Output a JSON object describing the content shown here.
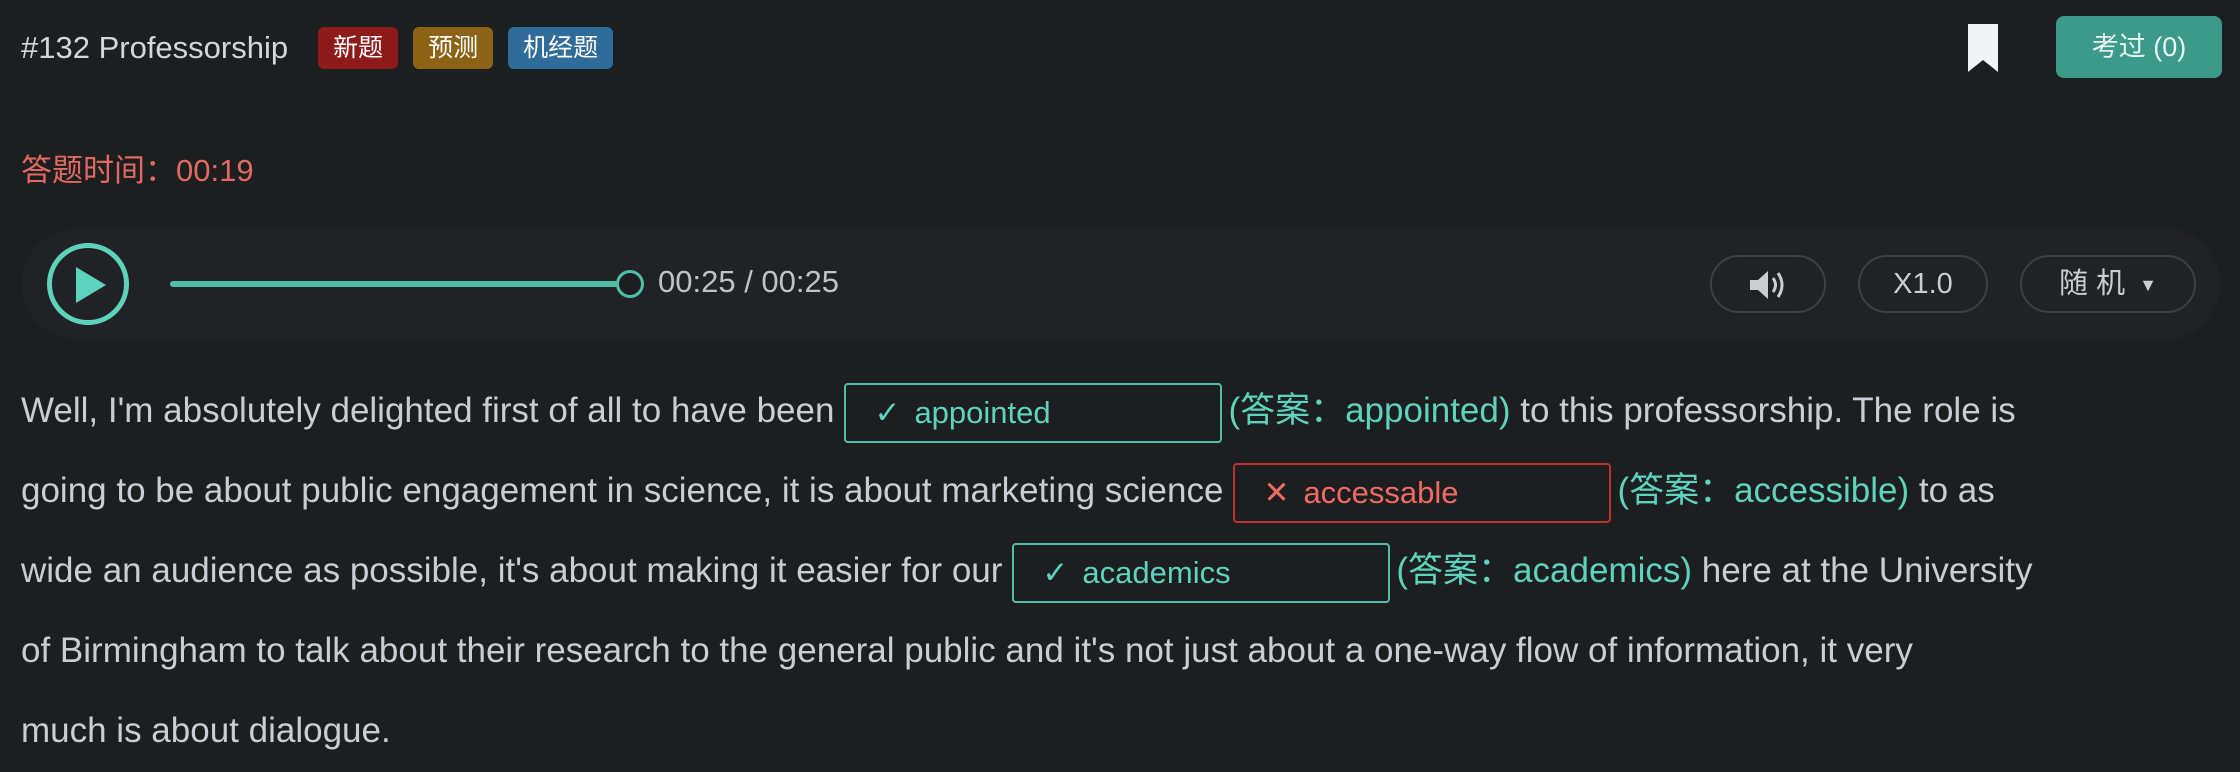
{
  "header": {
    "title": "#132 Professorship",
    "tags": {
      "new": "新题",
      "predict": "预测",
      "machine": "机经题"
    },
    "done_button": "考过 (0)"
  },
  "timer": "答题时间：00:19",
  "player": {
    "time": "00:25 / 00:25",
    "progress_percent": 100,
    "speed": "X1.0",
    "mode": "随 机",
    "icons": {
      "play": "play-icon",
      "volume": "volume-icon",
      "bookmark": "bookmark-icon"
    }
  },
  "passage": {
    "l1a": "Well, I'm absolutely delighted first of all to have been",
    "b1": {
      "mark": "✓",
      "value": "appointed",
      "status": "correct"
    },
    "a1": "(答案：appointed)",
    "l1b": " to this professorship. The role is",
    "l2a": "going to be about public engagement in science, it is about marketing science",
    "b2": {
      "mark": "✕",
      "value": "accessable",
      "status": "wrong"
    },
    "a2": "(答案：accessible)",
    "l2b": " to as",
    "l3a": "wide an audience as possible, it's about making it easier for our",
    "b3": {
      "mark": "✓",
      "value": "academics",
      "status": "correct"
    },
    "a3": "(答案：academics)",
    "l3b": " here at the University",
    "l4": "of Birmingham to talk about their research to the general public and it's not just about a one-way flow of information, it very",
    "l5": "much is about dialogue."
  },
  "colors": {
    "accent": "#4fbfa9",
    "error": "#ef6a62",
    "tag_new": "#8e1a1a",
    "tag_predict": "#8c6314",
    "tag_machine": "#2f6c99"
  }
}
